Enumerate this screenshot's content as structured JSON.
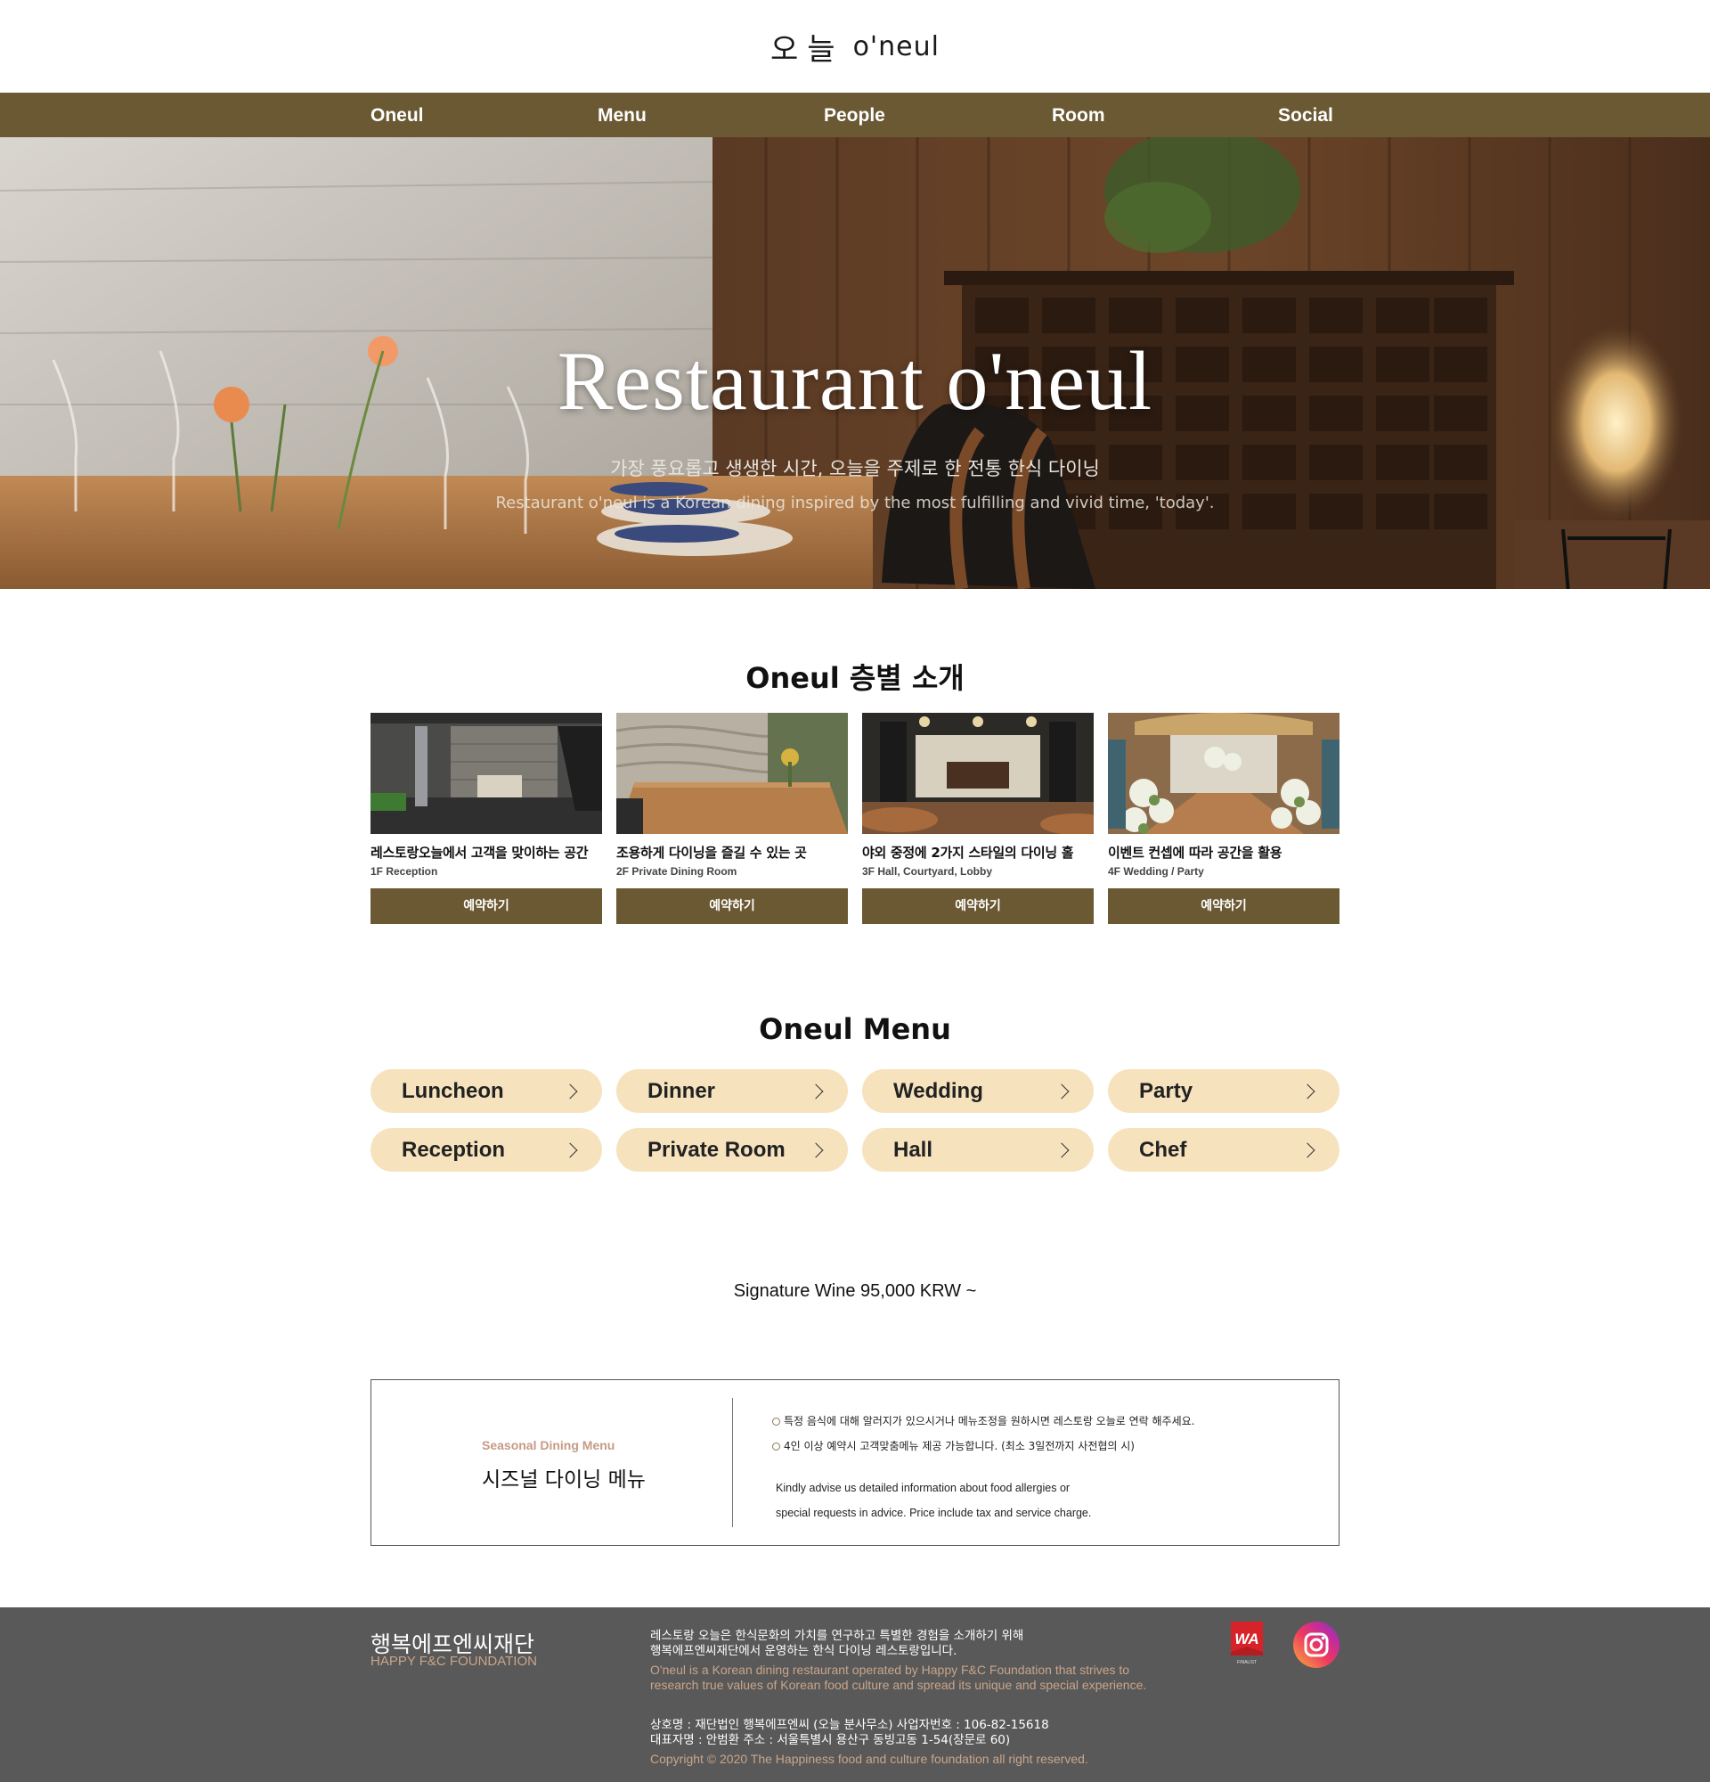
{
  "header": {
    "logo_ko": "오늘",
    "logo_en": "o'neul"
  },
  "nav": {
    "items": [
      {
        "label": "Oneul"
      },
      {
        "label": "Menu"
      },
      {
        "label": "People"
      },
      {
        "label": "Room"
      },
      {
        "label": "Social"
      }
    ]
  },
  "hero": {
    "title": "Restaurant o'neul",
    "subtitle_ko": "가장 풍요롭고 생생한 시간, 오늘을 주제로 한 전통 한식 다이닝",
    "subtitle_en": "Restaurant o'neul is a Korean dining inspired by the most fulfilling and vivid time, 'today'."
  },
  "floors": {
    "title": "Oneul 층별 소개",
    "cards": [
      {
        "title": "레스토랑오늘에서 고객을 맞이하는 공간",
        "subtitle": "1F Reception",
        "button": "예약하기"
      },
      {
        "title": "조용하게 다이닝을 즐길 수 있는 곳",
        "subtitle": "2F Private Dining Room",
        "button": "예약하기"
      },
      {
        "title": "야외 중정에 2가지 스타일의 다이닝 홀",
        "subtitle": "3F Hall, Courtyard, Lobby",
        "button": "예약하기"
      },
      {
        "title": "이벤트 컨셉에 따라 공간을 활용",
        "subtitle": "4F Wedding / Party",
        "button": "예약하기"
      }
    ]
  },
  "menu": {
    "title": "Oneul Menu",
    "items": [
      {
        "label": "Luncheon"
      },
      {
        "label": "Dinner"
      },
      {
        "label": "Wedding"
      },
      {
        "label": "Party"
      },
      {
        "label": "Reception"
      },
      {
        "label": "Private Room"
      },
      {
        "label": "Hall"
      },
      {
        "label": "Chef"
      }
    ]
  },
  "wine": {
    "text": "Signature Wine  95,000 KRW ~"
  },
  "seasonal": {
    "eng": "Seasonal Dining Menu",
    "ko": "시즈널 다이닝 메뉴",
    "notes": [
      "특정 음식에 대해 알러지가 있으시거나 메뉴조정을 원하시면 레스토랑 오늘로 연락 해주세요.",
      "4인 이상 예약시 고객맞춤메뉴 제공 가능합니다. (최소 3일전까지 사전협의 시)"
    ],
    "en_lines": [
      "Kindly advise us detailed information about food allergies or",
      "special requests in advice. Price include tax and service charge."
    ]
  },
  "footer": {
    "org_ko": "행복에프엔씨재단",
    "org_en": "HAPPY F&C FOUNDATION",
    "desc_ko_1": "레스토랑 오늘은 한식문화의 가치를 연구하고 특별한 경험을 소개하기 위해",
    "desc_ko_2": "행복에프엔씨재단에서 운영하는 한식 다이닝 레스토랑입니다.",
    "desc_en_1": "O'neul is a Korean dining restaurant operated by Happy F&C Foundation that strives to",
    "desc_en_2": "research true values of Korean food culture and spread its unique and special experience.",
    "info_1": "상호명 : 재단법인 행복에프엔씨 (오늘 분사무소) 사업자번호 : 106-82-15618",
    "info_2": "대표자명 : 안범환 주소 : 서울특별시 용산구 동빙고동 1-54(장문로 60)",
    "copyright": "Copyright © 2020 The Happiness food and culture foundation all right reserved.",
    "wa_badge": "WA",
    "wa_small": "FINALIST"
  },
  "colors": {
    "brand_brown": "#6b5933",
    "pill_bg": "#f6e3bd",
    "footer_bg": "#595959",
    "accent_tan": "#c9a58a"
  }
}
